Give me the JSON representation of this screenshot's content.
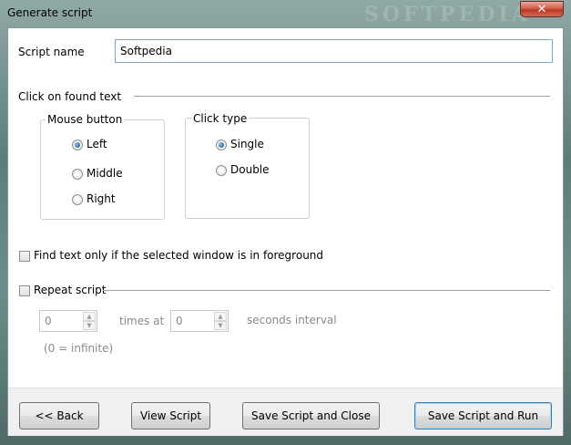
{
  "window": {
    "title": "Generate script",
    "close_glyph": "✕",
    "watermark": "SOFTPEDIA"
  },
  "script_name": {
    "label": "Script name",
    "value": "Softpedia"
  },
  "click_section": {
    "title": "Click on found text",
    "mouse_button": {
      "title": "Mouse button",
      "options": [
        "Left",
        "Middle",
        "Right"
      ],
      "selected": "Left"
    },
    "click_type": {
      "title": "Click type",
      "options": [
        "Single",
        "Double"
      ],
      "selected": "Single"
    }
  },
  "foreground_checkbox": {
    "label": "Find text only if the selected window is in foreground",
    "checked": false
  },
  "repeat": {
    "label": "Repeat script",
    "checked": false,
    "times_value": "0",
    "times_label": "times at",
    "interval_value": "0",
    "interval_label": "seconds interval",
    "hint": "(0 = infinite)"
  },
  "buttons": {
    "back": "<< Back",
    "view_script": "View Script",
    "save_close": "Save Script and Close",
    "save_run": "Save Script and Run"
  }
}
